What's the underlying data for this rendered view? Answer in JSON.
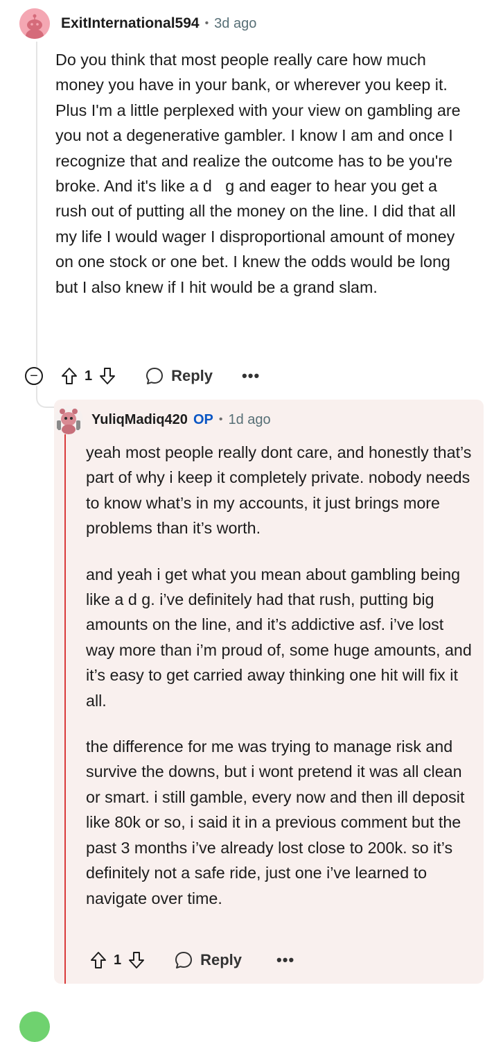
{
  "comment": {
    "username": "ExitInternational594",
    "separator": "•",
    "time": "3d ago",
    "body": "Do you think that most people really care how much money you have in your bank, or wherever you keep it. Plus I'm a little perplexed with your view on gambling are you not a degenerative gambler. I know I am and once I recognize that and realize the outcome has to be you're broke. And it's like a d   g and eager to hear you get a rush out of putting all the money on the line. I did that all my life I would wager I disproportional amount of money on one stock or one bet. I knew the odds would be long but I also knew if I hit would be a grand slam.",
    "vote_count": "1",
    "reply_label": "Reply",
    "more_label": "•••",
    "collapse_label": "−"
  },
  "reply": {
    "username": "YuliqMadiq420",
    "op_badge": "OP",
    "separator": "•",
    "time": "1d ago",
    "paragraphs": [
      "yeah most people really dont care, and honestly that’s part of why i keep it completely private. nobody needs to know what’s in my accounts, it just brings more problems than it’s worth.",
      "and yeah i get what you mean about gambling being like a d   g. i’ve definitely had that rush, putting big amounts on the line, and it’s addictive asf. i’ve lost way more than i’m proud of, some huge amounts, and it’s easy to get carried away thinking one hit will fix it all.",
      "the difference for me was trying to manage risk and survive the downs, but i wont pretend it was all clean or smart. i still gamble, every now and then ill deposit like 80k or so, i said it in a previous comment but the past 3 months i’ve already lost close to 200k. so it’s definitely not a safe ride, just one i’ve learned to navigate over time."
    ],
    "vote_count": "1",
    "reply_label": "Reply",
    "more_label": "•••"
  },
  "icons": {
    "upvote": "upvote-arrow-icon",
    "downvote": "downvote-arrow-icon",
    "reply": "speech-bubble-icon",
    "collapse": "minus-circle-icon"
  },
  "colors": {
    "op_badge": "#0a56c4",
    "op_card_bg": "#f9f0ee",
    "op_thread_line": "#d93a3a",
    "avatar1_bg": "#f4a7b3"
  }
}
